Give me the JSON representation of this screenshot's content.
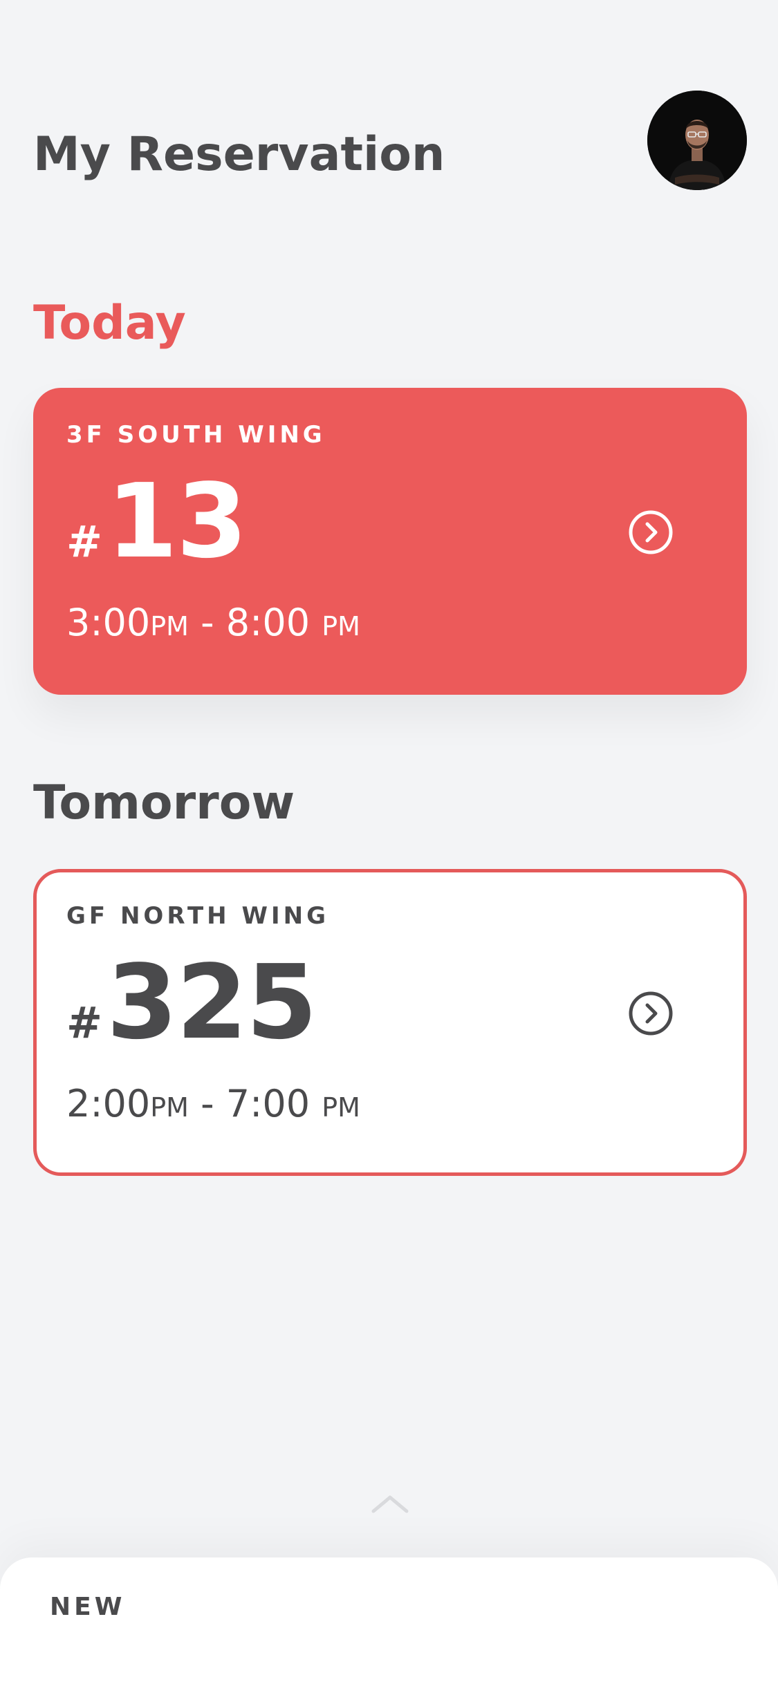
{
  "header": {
    "title": "My Reservation",
    "avatar_icon": "avatar-photo"
  },
  "sections": {
    "today": {
      "heading": "Today",
      "card": {
        "location": "3F SOUTH WING",
        "hash": "#",
        "number": "13",
        "start": "3:00",
        "start_ampm": "PM",
        "separator": " - ",
        "end": "8:00 ",
        "end_ampm": "PM",
        "arrow_icon": "chevron-right-circle-icon"
      }
    },
    "tomorrow": {
      "heading": "Tomorrow",
      "card": {
        "location": "GF NORTH WING",
        "hash": "#",
        "number": "325",
        "start": "2:00",
        "start_ampm": "PM",
        "separator": " - ",
        "end": "7:00 ",
        "end_ampm": "PM",
        "arrow_icon": "chevron-right-circle-icon"
      }
    }
  },
  "bottom_sheet": {
    "handle_icon": "chevron-up-icon",
    "label": "NEW"
  },
  "colors": {
    "background": "#f3f4f6",
    "accent": "#ec5a5a",
    "text": "#4a4a4c",
    "card_white": "#ffffff"
  }
}
